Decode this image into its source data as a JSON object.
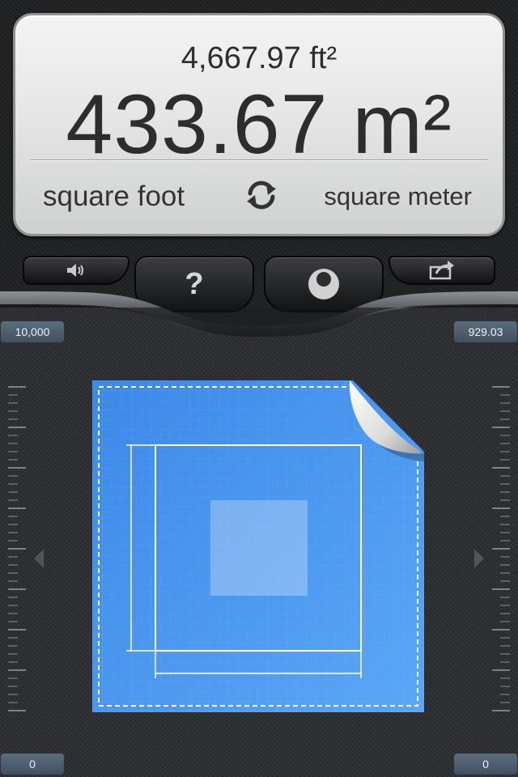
{
  "display": {
    "secondary_value": "4,667.97 ft²",
    "primary_value": "433.67 m²",
    "unit_from": "square foot",
    "unit_to": "square meter"
  },
  "toolbar": {
    "sound_icon": "speaker-icon",
    "help_label": "?",
    "theme_icon": "theme-icon",
    "share_icon": "share-icon"
  },
  "scale": {
    "top_left": "10,000",
    "top_right": "929.03",
    "bottom_left": "0",
    "bottom_right": "0"
  },
  "colors": {
    "accent_blue": "#4a93ee",
    "display_text": "#2d2d2d",
    "badge": "#4f5e6e"
  },
  "slider": {
    "level": 0.4667
  }
}
